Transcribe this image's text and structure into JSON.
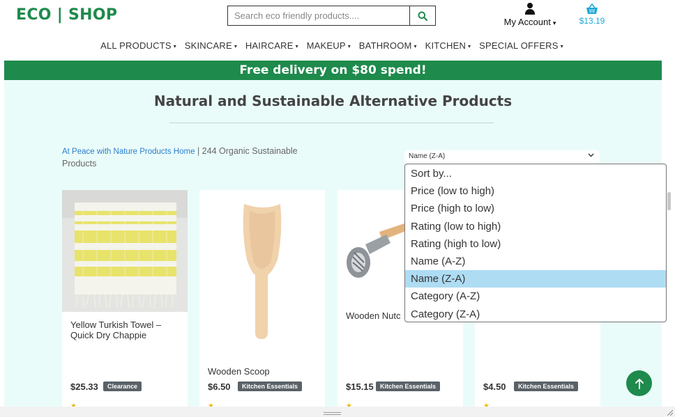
{
  "header": {
    "logo": "ECO | SHOP",
    "search_placeholder": "Search eco friendly products....",
    "account_label": "My Account",
    "cart_total": "$13.19"
  },
  "nav": {
    "items": [
      "ALL PRODUCTS",
      "SKINCARE",
      "HAIRCARE",
      "MAKEUP",
      "BATHROOM",
      "KITCHEN",
      "SPECIAL OFFERS"
    ]
  },
  "banner": "Free delivery on $80 spend!",
  "main": {
    "heading": "Natural and Sustainable Alternative Products",
    "breadcrumb_link": "At Peace with Nature Products Home",
    "breadcrumb_text": " | 244 Organic Sustainable Products",
    "sort_selected": "Name (Z-A)"
  },
  "sort_options": [
    "Sort by...",
    "Price (low to high)",
    "Price (high to low)",
    "Rating (low to high)",
    "Rating (high to low)",
    "Name (A-Z)",
    "Name (Z-A)",
    "Category (A-Z)",
    "Category (Z-A)"
  ],
  "products": [
    {
      "title": "Yellow Turkish Towel – Quick Dry Chappie",
      "price": "$25.33",
      "badge": "Clearance",
      "image": "yellow-striped-towel"
    },
    {
      "title": "Wooden Scoop",
      "price": "$6.50",
      "badge": "Kitchen Essentials",
      "image": "wooden-scoop"
    },
    {
      "title": "Wooden Nutc",
      "price": "$15.15",
      "badge": "Kitchen Essentials",
      "image": "wooden-nutcracker"
    },
    {
      "title": "",
      "price": "$4.50",
      "badge": "Kitchen Essentials",
      "image": ""
    }
  ],
  "colors": {
    "brand_green": "#1e8a4c",
    "cart_blue": "#1ca9d6",
    "page_bg": "#eafcf9",
    "selected_option": "#aedcf3"
  }
}
